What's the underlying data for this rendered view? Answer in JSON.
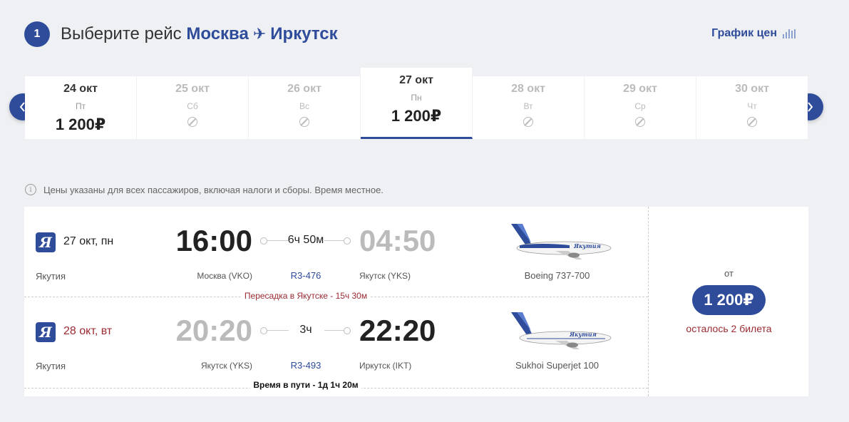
{
  "header": {
    "step": "1",
    "title_prefix": "Выберите рейс",
    "origin": "Москва",
    "destination": "Иркутск",
    "price_chart_label": "График цен"
  },
  "dates": [
    {
      "date": "24 окт",
      "weekday": "Пт",
      "price": "1 200₽",
      "available": true,
      "selected": false
    },
    {
      "date": "25 окт",
      "weekday": "Сб",
      "price": null,
      "available": false,
      "selected": false
    },
    {
      "date": "26 окт",
      "weekday": "Вс",
      "price": null,
      "available": false,
      "selected": false
    },
    {
      "date": "27 окт",
      "weekday": "Пн",
      "price": "1 200₽",
      "available": true,
      "selected": true
    },
    {
      "date": "28 окт",
      "weekday": "Вт",
      "price": null,
      "available": false,
      "selected": false
    },
    {
      "date": "29 окт",
      "weekday": "Ср",
      "price": null,
      "available": false,
      "selected": false
    },
    {
      "date": "30 окт",
      "weekday": "Чт",
      "price": null,
      "available": false,
      "selected": false
    }
  ],
  "notice": "Цены указаны для всех пассажиров, включая налоги и сборы. Время местное.",
  "segments": [
    {
      "airline_logo": "Я",
      "date": "27 окт, пн",
      "airline": "Якутия",
      "dep_time": "16:00",
      "arr_time": "04:50",
      "duration": "6ч 50м",
      "from_airport": "Москва (VKO)",
      "flight_no": "R3-476",
      "to_airport": "Якутск (YKS)",
      "aircraft": "Boeing 737-700"
    },
    {
      "airline_logo": "Я",
      "date": "28 окт, вт",
      "airline": "Якутия",
      "dep_time": "20:20",
      "arr_time": "22:20",
      "duration": "3ч",
      "from_airport": "Якутск (YKS)",
      "flight_no": "R3-493",
      "to_airport": "Иркутск (IKT)",
      "aircraft": "Sukhoi Superjet 100"
    }
  ],
  "transfer": "Пересадка в Якутске - 15ч 30м",
  "total_time": "Время в пути - 1д 1ч 20м",
  "price": {
    "from_label": "от",
    "amount": "1 200₽",
    "tickets_left": "осталось 2 билета"
  },
  "colors": {
    "accent": "#2e4c9a",
    "alert": "#9b2a32",
    "background": "#eef0f3"
  }
}
